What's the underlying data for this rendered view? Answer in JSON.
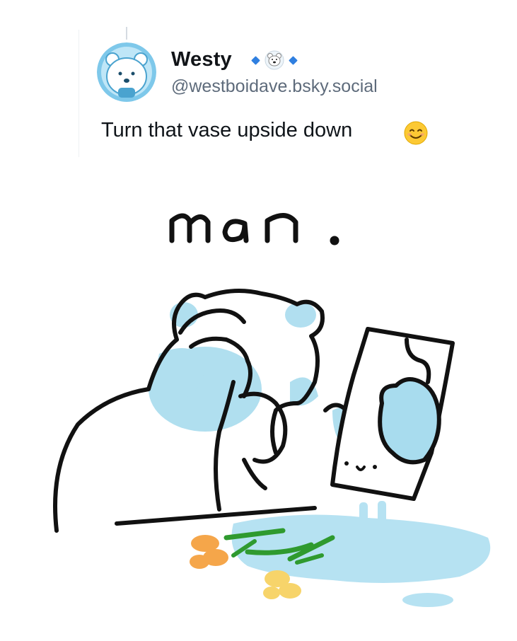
{
  "post": {
    "author": {
      "display_name": "Westy",
      "handle": "@westboidave.bsky.social",
      "avatar_icon": "polar-bear-avatar",
      "badge_icons": [
        "blue-diamond-icon",
        "polar-bear-face-icon",
        "blue-diamond-icon"
      ]
    },
    "text": "Turn that vase upside down",
    "emoji": "smiling-face-emoji",
    "image": {
      "kind": "hand-drawn comic",
      "caption": "man."
    }
  },
  "colors": {
    "accent": "#2f7fe0",
    "bear_blue": "#a8dcee",
    "flower_orange": "#f5a64a",
    "flower_yellow": "#f7d46a",
    "stem_green": "#2f9a2f"
  }
}
